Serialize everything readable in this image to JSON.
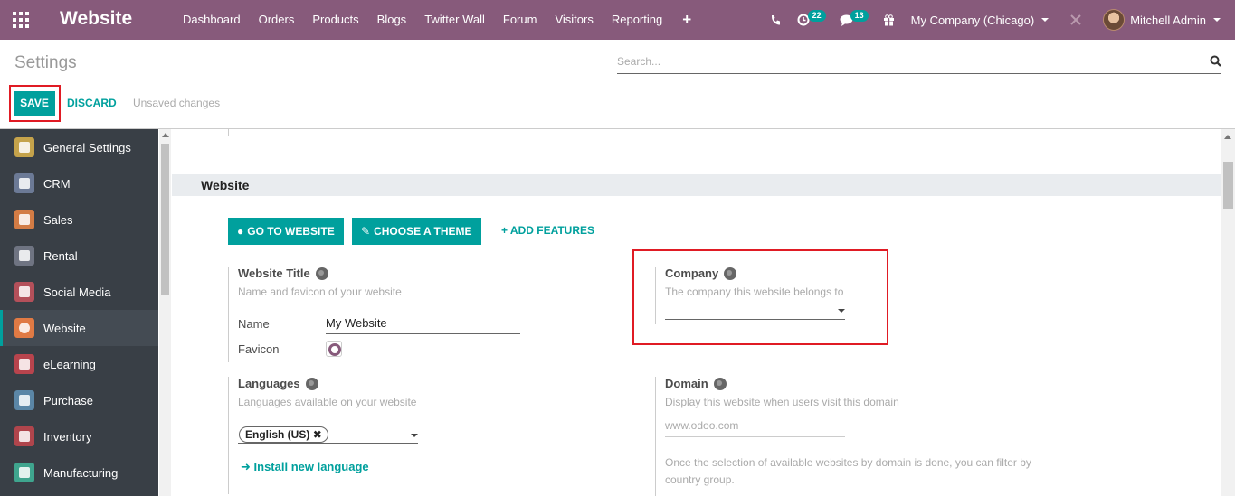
{
  "navbar": {
    "brand": "Website",
    "menu": [
      "Dashboard",
      "Orders",
      "Products",
      "Blogs",
      "Twitter Wall",
      "Forum",
      "Visitors",
      "Reporting"
    ],
    "activities_count": "22",
    "messages_count": "13",
    "company": "My Company (Chicago)",
    "user": "Mitchell Admin",
    "accent_color": "#875a7b"
  },
  "control_panel": {
    "title": "Settings",
    "search_placeholder": "Search...",
    "save_label": "SAVE",
    "discard_label": "DISCARD",
    "status": "Unsaved changes"
  },
  "sidebar": {
    "items": [
      {
        "label": "General Settings",
        "color": "#c5a34b"
      },
      {
        "label": "CRM",
        "color": "#6c7a96"
      },
      {
        "label": "Sales",
        "color": "#d37c45"
      },
      {
        "label": "Rental",
        "color": "#6f7482"
      },
      {
        "label": "Social Media",
        "color": "#b4505a"
      },
      {
        "label": "Website",
        "color": "#e07a44"
      },
      {
        "label": "eLearning",
        "color": "#b8444d"
      },
      {
        "label": "Purchase",
        "color": "#5b86a6"
      },
      {
        "label": "Inventory",
        "color": "#b0454c"
      },
      {
        "label": "Manufacturing",
        "color": "#3fa58e"
      }
    ],
    "active": "Website"
  },
  "section": {
    "title": "Website",
    "buttons": {
      "go_to_website": "GO TO WEBSITE",
      "choose_theme": "CHOOSE A THEME",
      "add_features": "ADD FEATURES"
    },
    "website_title": {
      "label": "Website Title",
      "help": "Name and favicon of your website",
      "name_label": "Name",
      "name_value": "My Website",
      "favicon_label": "Favicon"
    },
    "company": {
      "label": "Company",
      "help": "The company this website belongs to",
      "value": ""
    },
    "languages": {
      "label": "Languages",
      "help": "Languages available on your website",
      "tags": [
        "English (US)"
      ],
      "install_link": "Install new language"
    },
    "domain": {
      "label": "Domain",
      "help": "Display this website when users visit this domain",
      "placeholder": "www.odoo.com",
      "note": "Once the selection of available websites by domain is done, you can filter by country group."
    }
  }
}
